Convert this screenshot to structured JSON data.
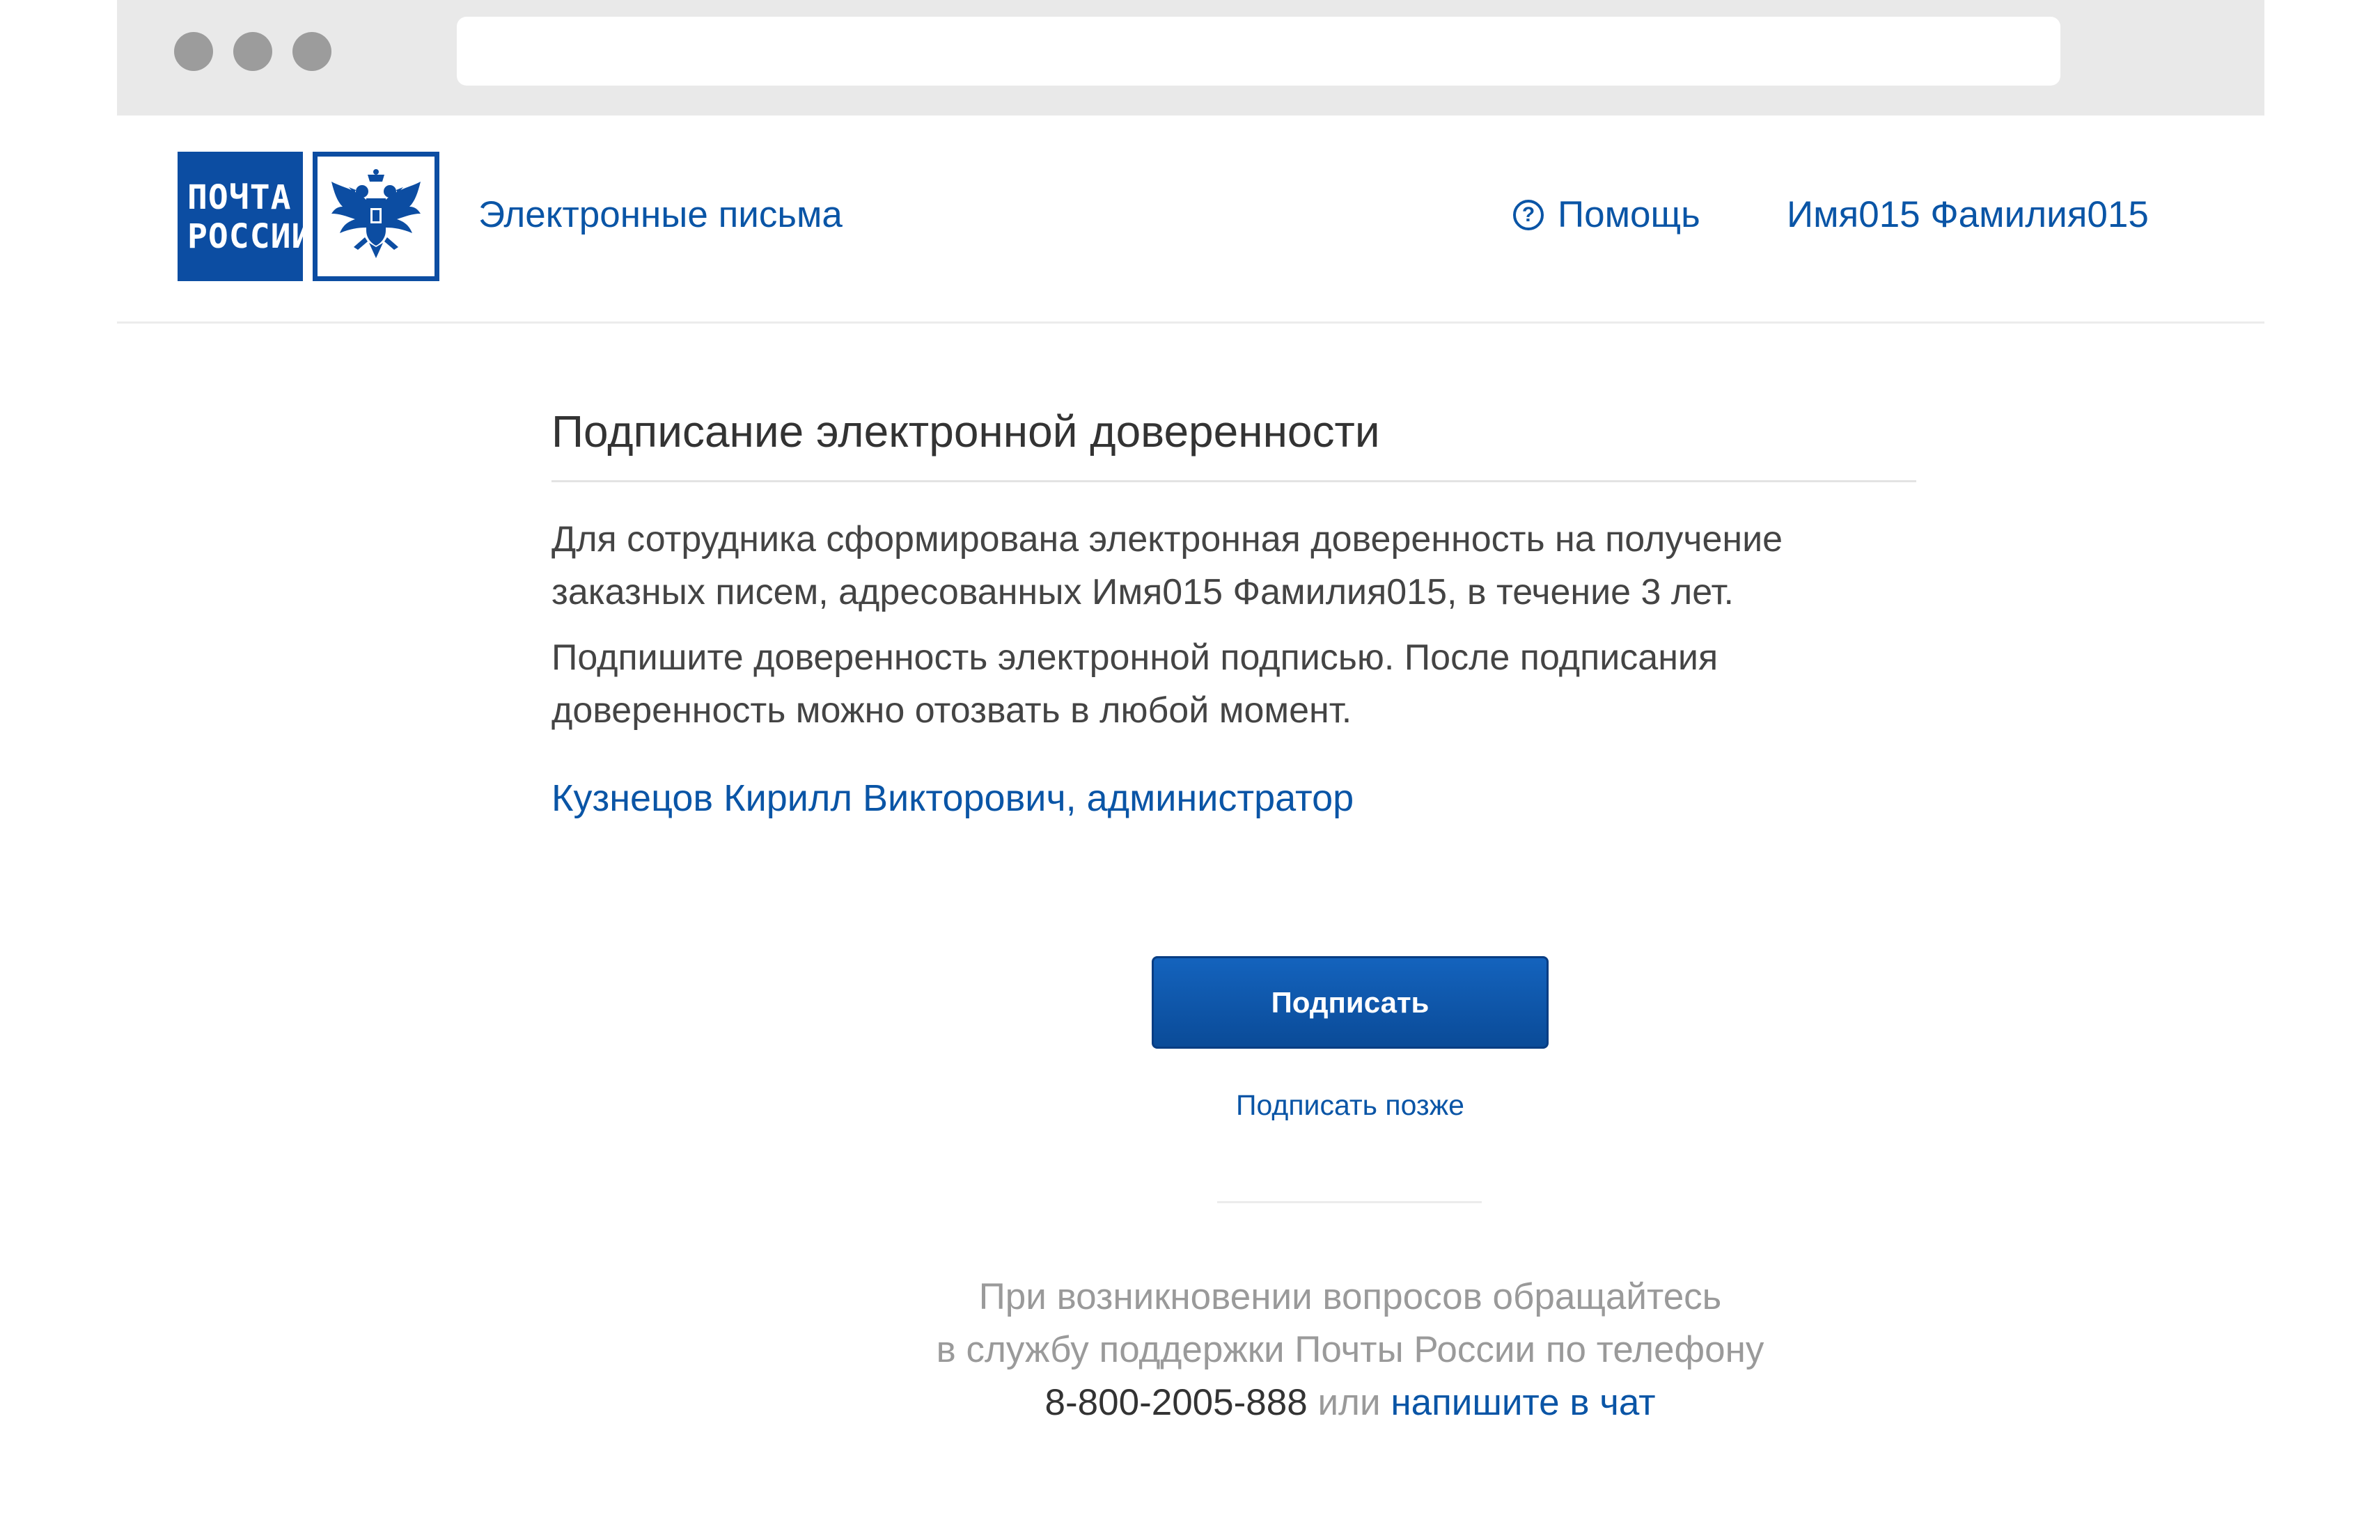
{
  "header": {
    "logo_line1": "ПОЧТА",
    "logo_line2": "РОССИИ",
    "site_name": "Электронные письма",
    "help_label": "Помощь",
    "user_name": "Имя015 Фамилия015"
  },
  "icons": {
    "help": "question-circle-icon",
    "emblem": "double-headed-eagle-icon"
  },
  "main": {
    "title": "Подписание электронной доверенности",
    "paragraph1": "Для сотрудника сформирована электронная доверенность на получение заказных писем, адресованных Имя015 Фамилия015, в течение 3 лет.",
    "paragraph2": "Подпишите доверенность электронной подписью. После подписания доверенность можно отозвать в любой момент.",
    "signer": "Кузнецов Кирилл Викторович, администратор",
    "sign_button": "Подписать",
    "sign_later": "Подписать позже"
  },
  "support": {
    "line1": "При возникновении вопросов обращайтесь",
    "line2": "в службу поддержки Почты России по телефону",
    "phone": "8-800-2005-888",
    "or": "или",
    "chat_link": "напишите в чат"
  },
  "colors": {
    "brand_blue": "#0c4da2",
    "link_blue": "#0a55a6",
    "button_blue": "#0a4b98",
    "chrome_gray": "#e9e9e9",
    "muted_text": "#9a9a9a"
  }
}
